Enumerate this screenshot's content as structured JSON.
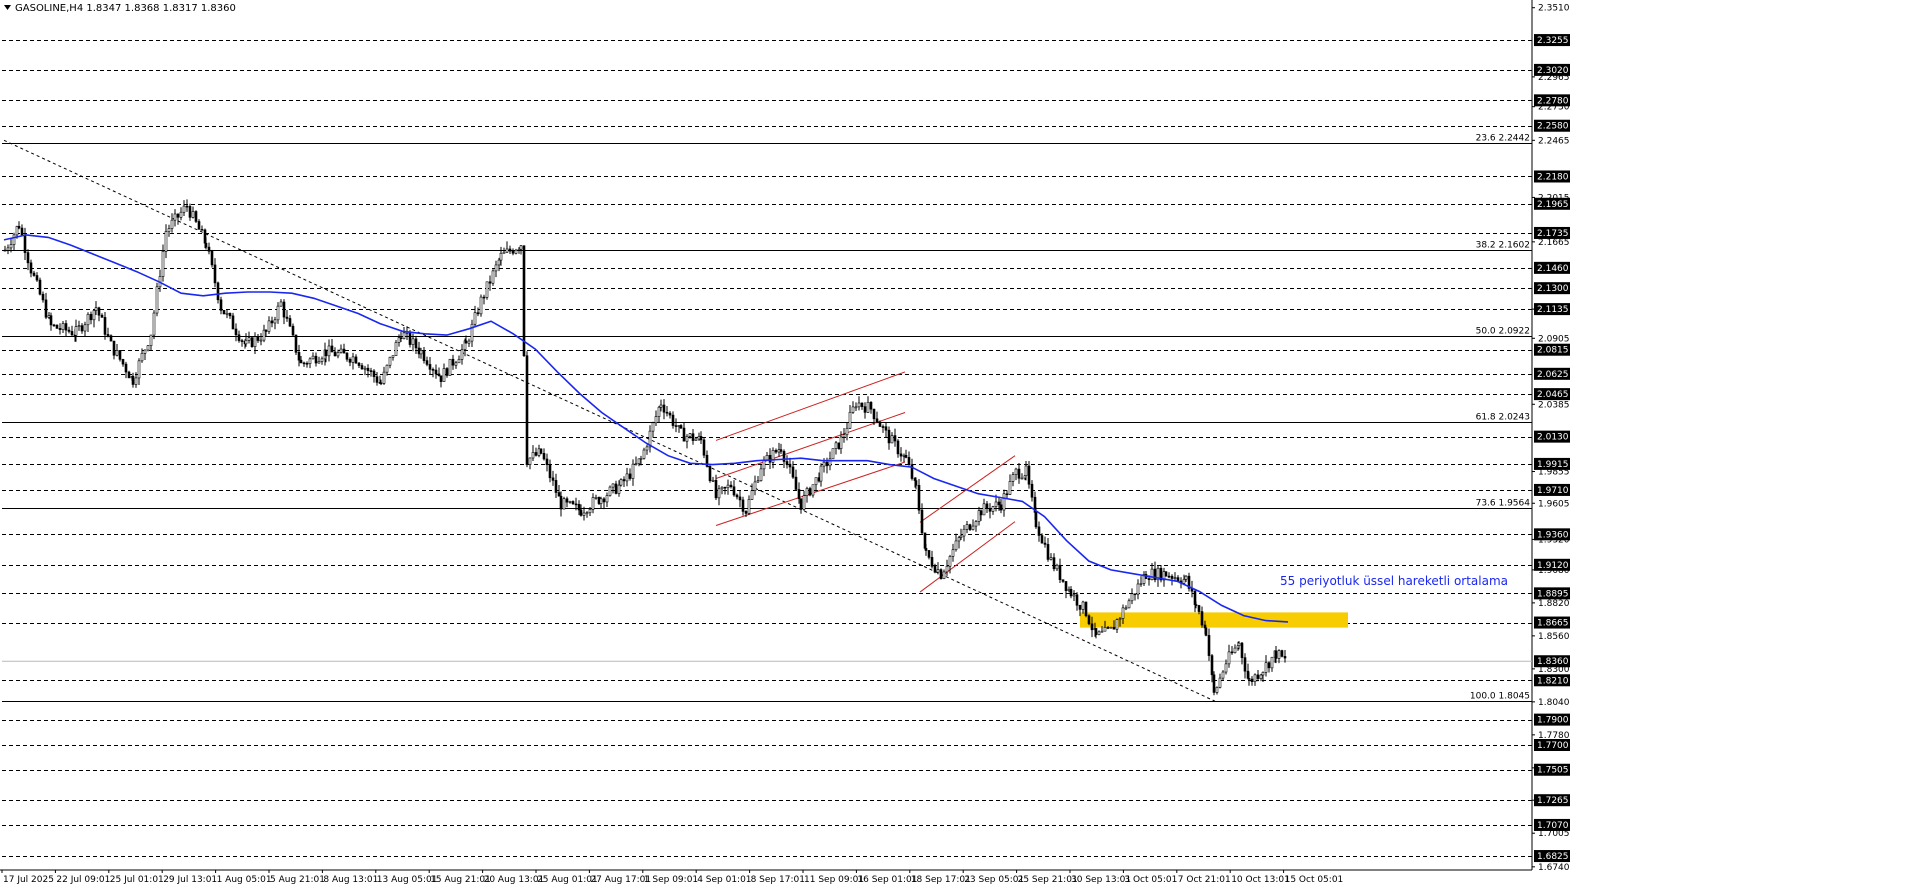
{
  "chart_data": {
    "type": "candlestick",
    "header": {
      "symbol_timeframe": "GASOLINE,H4",
      "open": "1.8347",
      "high": "1.8368",
      "low": "1.8317",
      "close": "1.8360"
    },
    "y_range": [
      1.6715,
      2.3555
    ],
    "x_tick_labels": [
      "17 Jul 2025",
      "22 Jul 09:01",
      "25 Jul 01:01",
      "29 Jul 13:01",
      "1 Aug 05:01",
      "5 Aug 21:01",
      "8 Aug 13:01",
      "13 Aug 05:01",
      "15 Aug 21:01",
      "20 Aug 13:01",
      "25 Aug 01:01",
      "27 Aug 17:01",
      "1 Sep 09:01",
      "4 Sep 01:01",
      "8 Sep 17:01",
      "11 Sep 09:01",
      "16 Sep 01:01",
      "18 Sep 17:01",
      "23 Sep 05:01",
      "25 Sep 21:01",
      "30 Sep 13:01",
      "3 Oct 05:01",
      "7 Oct 21:01",
      "10 Oct 13:01",
      "15 Oct 05:01"
    ],
    "y_tick_labels": [
      "2.3510",
      "2.2965",
      "2.2730",
      "2.2465",
      "2.2015",
      "2.1665",
      "2.1135",
      "2.0905",
      "2.0385",
      "1.9855",
      "1.9605",
      "1.9320",
      "1.9080",
      "1.8820",
      "1.8560",
      "1.8300",
      "1.8040",
      "1.7780",
      "1.7520",
      "1.7265",
      "1.7005",
      "1.6740"
    ],
    "horizontal_levels": [
      {
        "price": 2.3255,
        "label": "2.3255"
      },
      {
        "price": 2.302,
        "label": "2.3020"
      },
      {
        "price": 2.278,
        "label": "2.2780"
      },
      {
        "price": 2.258,
        "label": "2.2580"
      },
      {
        "price": 2.218,
        "label": "2.2180"
      },
      {
        "price": 2.1965,
        "label": "2.1965"
      },
      {
        "price": 2.1735,
        "label": "2.1735"
      },
      {
        "price": 2.146,
        "label": "2.1460"
      },
      {
        "price": 2.13,
        "label": "2.1300"
      },
      {
        "price": 2.1135,
        "label": "2.1135"
      },
      {
        "price": 2.0815,
        "label": "2.0815"
      },
      {
        "price": 2.0625,
        "label": "2.0625"
      },
      {
        "price": 2.0465,
        "label": "2.0465"
      },
      {
        "price": 2.013,
        "label": "2.0130"
      },
      {
        "price": 1.9915,
        "label": "1.9915"
      },
      {
        "price": 1.971,
        "label": "1.9710"
      },
      {
        "price": 1.936,
        "label": "1.9360"
      },
      {
        "price": 1.912,
        "label": "1.9120"
      },
      {
        "price": 1.8895,
        "label": "1.8895"
      },
      {
        "price": 1.8665,
        "label": "1.8665"
      },
      {
        "price": 1.821,
        "label": "1.8210"
      },
      {
        "price": 1.79,
        "label": "1.7900"
      },
      {
        "price": 1.77,
        "label": "1.7700"
      },
      {
        "price": 1.7505,
        "label": "1.7505"
      },
      {
        "price": 1.7265,
        "label": "1.7265"
      },
      {
        "price": 1.707,
        "label": "1.7070"
      },
      {
        "price": 1.6825,
        "label": "1.6825"
      }
    ],
    "fibonacci_levels": [
      {
        "ratio": "23.6",
        "price": 2.2442,
        "label": "23.6 2.2442"
      },
      {
        "ratio": "38.2",
        "price": 2.1602,
        "label": "38.2 2.1602"
      },
      {
        "ratio": "50.0",
        "price": 2.0922,
        "label": "50.0 2.0922"
      },
      {
        "ratio": "61.8",
        "price": 2.0243,
        "label": "61.8 2.0243"
      },
      {
        "ratio": "73.6",
        "price": 1.9564,
        "label": "73.6 1.9564"
      },
      {
        "ratio": "100.0",
        "price": 1.8045,
        "label": "100.0 1.8045"
      }
    ],
    "current_price": {
      "price": 1.836,
      "label": "1.8360"
    },
    "ema_annotation": "55 periyotluk üssel hareketli ortalama",
    "ema_points": [
      [
        2.168
      ],
      [
        2.172
      ],
      [
        2.17
      ],
      [
        2.164
      ],
      [
        2.157
      ],
      [
        2.15
      ],
      [
        2.143
      ],
      [
        2.135
      ],
      [
        2.126
      ],
      [
        2.124
      ],
      [
        2.126
      ],
      [
        2.127
      ],
      [
        2.127
      ],
      [
        2.126
      ],
      [
        2.122
      ],
      [
        2.116
      ],
      [
        2.11
      ],
      [
        2.102
      ],
      [
        2.096
      ],
      [
        2.094
      ],
      [
        2.093
      ],
      [
        2.098
      ],
      [
        2.104
      ],
      [
        2.094
      ],
      [
        2.082
      ],
      [
        2.064
      ],
      [
        2.047
      ],
      [
        2.032
      ],
      [
        2.02
      ],
      [
        2.008
      ],
      [
        1.998
      ],
      [
        1.992
      ],
      [
        1.991
      ],
      [
        1.992
      ],
      [
        1.994
      ],
      [
        1.995
      ],
      [
        1.996
      ],
      [
        1.994
      ],
      [
        1.994
      ],
      [
        1.994
      ],
      [
        1.991
      ],
      [
        1.989
      ],
      [
        1.98
      ],
      [
        1.974
      ],
      [
        1.968
      ],
      [
        1.965
      ],
      [
        1.962
      ],
      [
        1.95
      ],
      [
        1.931
      ],
      [
        1.915
      ],
      [
        1.908
      ],
      [
        1.905
      ],
      [
        1.902
      ],
      [
        1.899
      ],
      [
        1.891
      ],
      [
        1.88
      ],
      [
        1.872
      ],
      [
        1.868
      ],
      [
        1.867
      ]
    ],
    "ohlc_start_price": 2.16,
    "zone": {
      "top": 1.8745,
      "bottom": 1.8625,
      "color": "#f7cc00"
    },
    "colors": {
      "candle": "#000000",
      "ema": "#1a27f0",
      "channel": "#cc2222",
      "grid": "#000000",
      "annotation": "#1a27f0",
      "tag_bg": "#000000",
      "tag_text": "#ffffff"
    }
  }
}
